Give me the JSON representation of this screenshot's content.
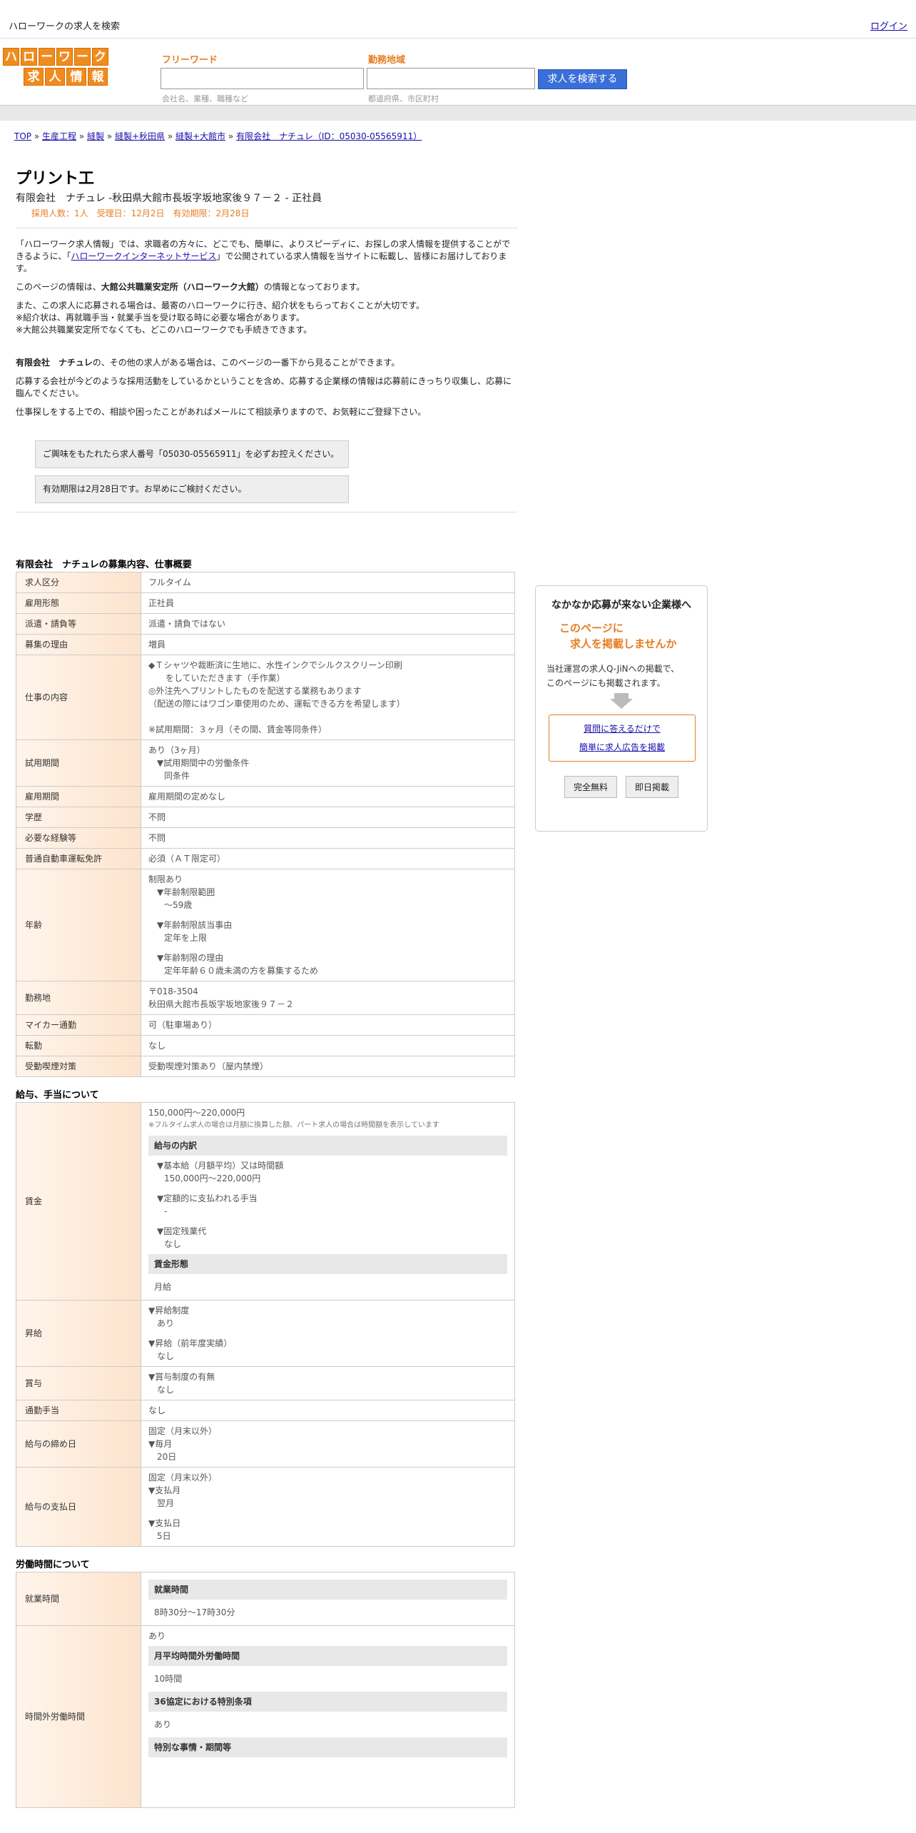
{
  "topbar": {
    "site_title": "ハローワークの求人を検索",
    "login": "ログイン"
  },
  "logo": {
    "row1": [
      "ハ",
      "ロ",
      "ー",
      "ワ",
      "ー",
      "ク"
    ],
    "row2": [
      "求",
      "人",
      "情",
      "報"
    ]
  },
  "search": {
    "keyword_label": "フリーワード",
    "keyword_hint": "会社名、業種、職種など",
    "area_label": "勤務地域",
    "area_hint": "都道府県、市区町村",
    "button": "求人を検索する"
  },
  "breadcrumb": {
    "items": [
      "TOP",
      "生産工程",
      "縫製",
      "縫製+秋田県",
      "縫製+大館市",
      "有限会社　ナチュレ（ID：05030-05565911）"
    ],
    "sep": " » "
  },
  "job": {
    "title": "プリント工",
    "company_line": "有限会社　ナチュレ -秋田県大館市長坂字坂地家後９７－２ - 正社員",
    "meta": "採用人数：1人　受理日：12月2日　有効期限：2月28日"
  },
  "intro": {
    "p1_a": "「ハローワーク求人情報」では、求職者の方々に、どこでも、簡単に、よりスピーディに、お探しの求人情報を提供することができるように、「",
    "p1_link": "ハローワークインターネットサービス",
    "p1_b": "」で公開されている求人情報を当サイトに転載し、皆様にお届けしております。",
    "p2_a": "このページの情報は、",
    "p2_bold": "大館公共職業安定所（ハローワーク大館）",
    "p2_b": "の情報となっております。",
    "p3_1": "また、この求人に応募される場合は、最寄のハローワークに行き、紹介状をもらっておくことが大切です。",
    "p3_2": "※紹介状は、再就職手当・就業手当を受け取る時に必要な場合があります。",
    "p3_3": "※大館公共職業安定所でなくても、どこのハローワークでも手続きできます。",
    "p4_bold": "有限会社　ナチュレ",
    "p4_b": "の、その他の求人がある場合は、このページの一番下から見ることができます。",
    "p5": "応募する会社が今どのような採用活動をしているかということを含め、応募する企業様の情報は応募前にきっちり収集し、応募に臨んでください。",
    "p6": "仕事探しをする上での、相談や困ったことがあればメールにて相談承りますので、お気軽にご登録下さい。",
    "notice1": "ご興味をもたれたら求人番号「05030-05565911」を必ずお控えください。",
    "notice2": "有効期限は2月28日です。お早めにご検討ください。"
  },
  "overview": {
    "title": "有限会社　ナチュレの募集内容、仕事概要",
    "rows": {
      "kubun": [
        "求人区分",
        "フルタイム"
      ],
      "koyo": [
        "雇用形態",
        "正社員"
      ],
      "haken": [
        "派遣・請負等",
        "派遣・請負ではない"
      ],
      "riyu": [
        "募集の理由",
        "増員"
      ],
      "shigoto_label": "仕事の内容",
      "shigoto": [
        "◆Ｔシャツや裁断済に生地に、水性インクでシルクスクリーン印刷",
        "　をしていただきます（手作業）",
        "◎外注先へプリントしたものを配送する業務もあります",
        "（配送の際にはワゴン車使用のため、運転できる方を希望します）",
        "",
        "※試用期間：３ヶ月（その間、賃金等同条件）"
      ],
      "shiyo_label": "試用期間",
      "shiyo": [
        "あり（3ヶ月）",
        "▼試用期間中の労働条件",
        "同条件"
      ],
      "kikan": [
        "雇用期間",
        "雇用期間の定めなし"
      ],
      "gakureki": [
        "学歴",
        "不問"
      ],
      "keiken": [
        "必要な経験等",
        "不問"
      ],
      "menkyo": [
        "普通自動車運転免許",
        "必須（ＡＴ限定可）"
      ],
      "nenrei_label": "年齢",
      "nenrei": [
        "制限あり",
        "▼年齢制限範囲",
        "〜59歳",
        "▼年齢制限該当事由",
        "定年を上限",
        "▼年齢制限の理由",
        "定年年齢６０歳未満の方を募集するため"
      ],
      "kinmuchi_label": "勤務地",
      "kinmuchi": [
        "〒018-3504",
        "秋田県大館市長坂字坂地家後９７－２"
      ],
      "mycar": [
        "マイカー通勤",
        "可（駐車場あり）"
      ],
      "tenkin": [
        "転勤",
        "なし"
      ],
      "judo": [
        "受動喫煙対策",
        "受動喫煙対策あり（屋内禁煙）"
      ]
    }
  },
  "salary": {
    "title": "給与、手当について",
    "chingin_label": "賃金",
    "chingin_range": "150,000円〜220,000円",
    "chingin_note": "※フルタイム求人の場合は月額に換算した額、パート求人の場合は時間額を表示しています",
    "uchiwake_head": "給与の内訳",
    "kihon": "▼基本給（月額平均）又は時間額",
    "kihon_val": "150,000円〜220,000円",
    "teigaku": "▼定額的に支払われる手当",
    "teigaku_val": "-",
    "kotei": "▼固定残業代",
    "kotei_val": "なし",
    "keitai_head": "賃金形態",
    "keitai_val": "月給",
    "shokyu_label": "昇給",
    "shokyu": [
      "▼昇給制度",
      "あり",
      "▼昇給（前年度実績）",
      "なし"
    ],
    "shoyo_label": "賞与",
    "shoyo": [
      "▼賞与制度の有無",
      "なし"
    ],
    "tsukin": [
      "通勤手当",
      "なし"
    ],
    "shime_label": "給与の締め日",
    "shime": [
      "固定（月末以外）",
      "▼毎月",
      "20日"
    ],
    "shiharai_label": "給与の支払日",
    "shiharai": [
      "固定（月末以外）",
      "▼支払月",
      "翌月",
      "▼支払日",
      "5日"
    ]
  },
  "hours": {
    "title": "労働時間について",
    "shugyo_label": "就業時間",
    "shugyo_head": "就業時間",
    "shugyo_val": "8時30分〜17時30分",
    "jikangai_label": "時間外労働時間",
    "jikangai_val": "あり",
    "heikin_head": "月平均時間外労働時間",
    "heikin_val": "10時間",
    "tokubetsu_head": "36協定における特別条項",
    "tokubetsu_val": "あり",
    "jijo_head": "特別な事情・期間等"
  },
  "side": {
    "title": "なかなか応募が来ない企業様へ",
    "orange1": "このページに",
    "orange2": "　求人を掲載しませんか",
    "text1": "当社運営の求人Q-JiNへの掲載で、",
    "text2": "このページにも掲載されます。",
    "link1": "質問に答えるだけで",
    "link2": "簡単に求人広告を掲載",
    "btn1": "完全無料",
    "btn2": "即日掲載"
  }
}
